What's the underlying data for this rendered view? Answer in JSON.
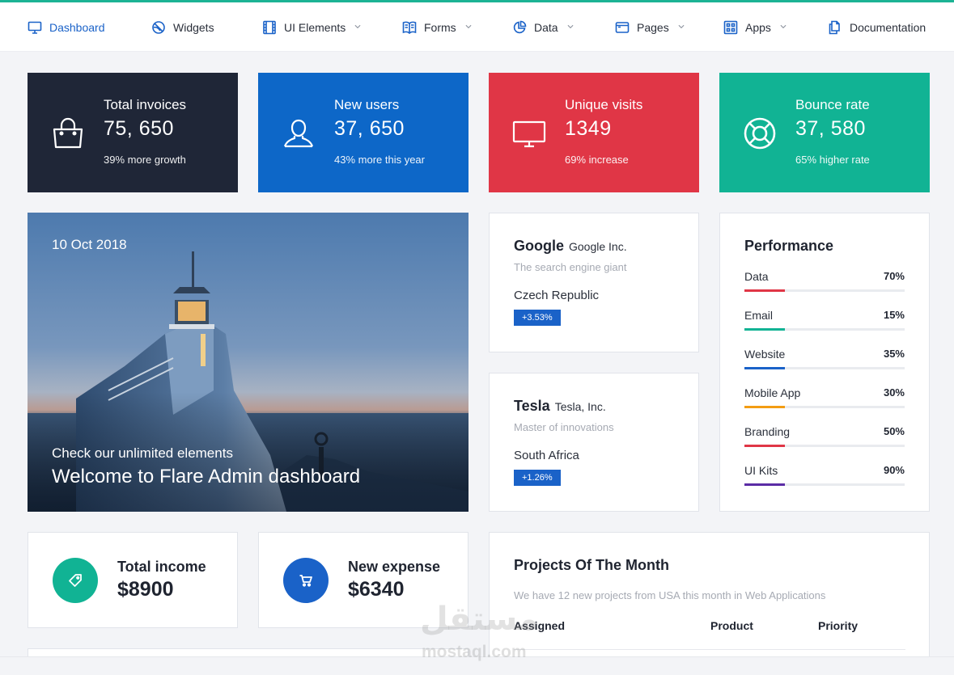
{
  "nav": {
    "items": [
      {
        "label": "Dashboard",
        "icon": "monitor-icon",
        "dropdown": false,
        "active": true
      },
      {
        "label": "Widgets",
        "icon": "globe-slash-icon",
        "dropdown": false
      },
      {
        "label": "UI Elements",
        "icon": "film-icon",
        "dropdown": true
      },
      {
        "label": "Forms",
        "icon": "book-icon",
        "dropdown": true
      },
      {
        "label": "Data",
        "icon": "pie-chart-icon",
        "dropdown": true
      },
      {
        "label": "Pages",
        "icon": "browser-icon",
        "dropdown": true
      },
      {
        "label": "Apps",
        "icon": "grid-icon",
        "dropdown": true
      },
      {
        "label": "Documentation",
        "icon": "documents-icon",
        "dropdown": false
      }
    ],
    "accent_color": "#1cb394",
    "active_color": "#1a62c8"
  },
  "stats": [
    {
      "title": "Total invoices",
      "value": "75, 650",
      "sub": "39% more growth",
      "icon": "shopping-bag-icon",
      "color": "#1f2637"
    },
    {
      "title": "New users",
      "value": "37, 650",
      "sub": "43% more this year",
      "icon": "user-icon",
      "color": "#0d67c8"
    },
    {
      "title": "Unique visits",
      "value": "1349",
      "sub": "69% increase",
      "icon": "desktop-icon",
      "color": "#e03646"
    },
    {
      "title": "Bounce rate",
      "value": "37, 580",
      "sub": "65% higher rate",
      "icon": "lifebuoy-icon",
      "color": "#11b394"
    }
  ],
  "hero": {
    "date": "10 Oct 2018",
    "subtitle": "Check our unlimited elements",
    "title": "Welcome to Flare Admin dashboard"
  },
  "companies": [
    {
      "name": "Google",
      "inc": "Google Inc.",
      "tagline": "The search engine giant",
      "country": "Czech Republic",
      "badge": "+3.53%"
    },
    {
      "name": "Tesla",
      "inc": "Tesla, Inc.",
      "tagline": "Master of innovations",
      "country": "South Africa",
      "badge": "+1.26%"
    }
  ],
  "performance": {
    "title": "Performance",
    "rows": [
      {
        "label": "Data",
        "value": "70%",
        "color": "#e03646"
      },
      {
        "label": "Email",
        "value": "15%",
        "color": "#11b394"
      },
      {
        "label": "Website",
        "value": "35%",
        "color": "#1a62c8"
      },
      {
        "label": "Mobile App",
        "value": "30%",
        "color": "#f39c12"
      },
      {
        "label": "Branding",
        "value": "50%",
        "color": "#e03646"
      },
      {
        "label": "UI Kits",
        "value": "90%",
        "color": "#5b2ca5"
      }
    ]
  },
  "income": {
    "label": "Total income",
    "value": "$8900",
    "icon": "tag-icon",
    "color": "#11b394"
  },
  "expense": {
    "label": "New expense",
    "value": "$6340",
    "icon": "cart-icon",
    "color": "#1a62c8"
  },
  "projects": {
    "title": "Projects Of The Month",
    "description": "We have 12 new projects from USA this month in Web Applications",
    "columns": [
      "Assigned",
      "Product",
      "Priority"
    ]
  },
  "watermark": {
    "arabic": "مستقل",
    "latin": "mostaql.com"
  }
}
